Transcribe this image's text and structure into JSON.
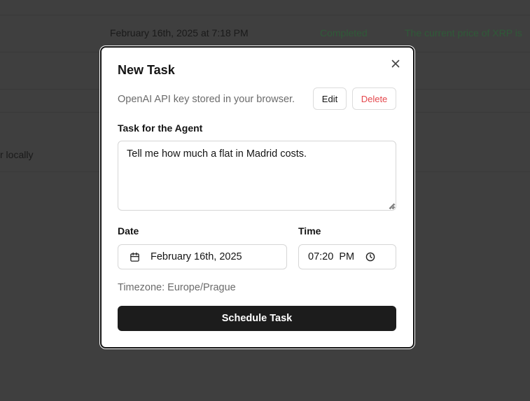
{
  "background": {
    "row1": {
      "date": "February 16th, 2025 at 7:18 PM",
      "status": "Completed",
      "result": "The current price of XRP is"
    },
    "row_partial_text": "r locally"
  },
  "modal": {
    "title": "New Task",
    "api_note": "OpenAI API key stored in your browser.",
    "edit_label": "Edit",
    "delete_label": "Delete",
    "task_label": "Task for the Agent",
    "task_value": "Tell me how much a flat in Madrid costs.",
    "date_label": "Date",
    "date_value": "February 16th, 2025",
    "time_label": "Time",
    "time_value": "07:20  PM",
    "timezone": "Timezone: Europe/Prague",
    "submit_label": "Schedule Task"
  },
  "icons": {
    "close": "close-icon",
    "calendar": "calendar-icon",
    "clock": "clock-icon"
  },
  "colors": {
    "overlay": "#3f3f3f",
    "primary": "#1c1c1c",
    "danger": "#e5484d",
    "status": "#2f5a38"
  }
}
